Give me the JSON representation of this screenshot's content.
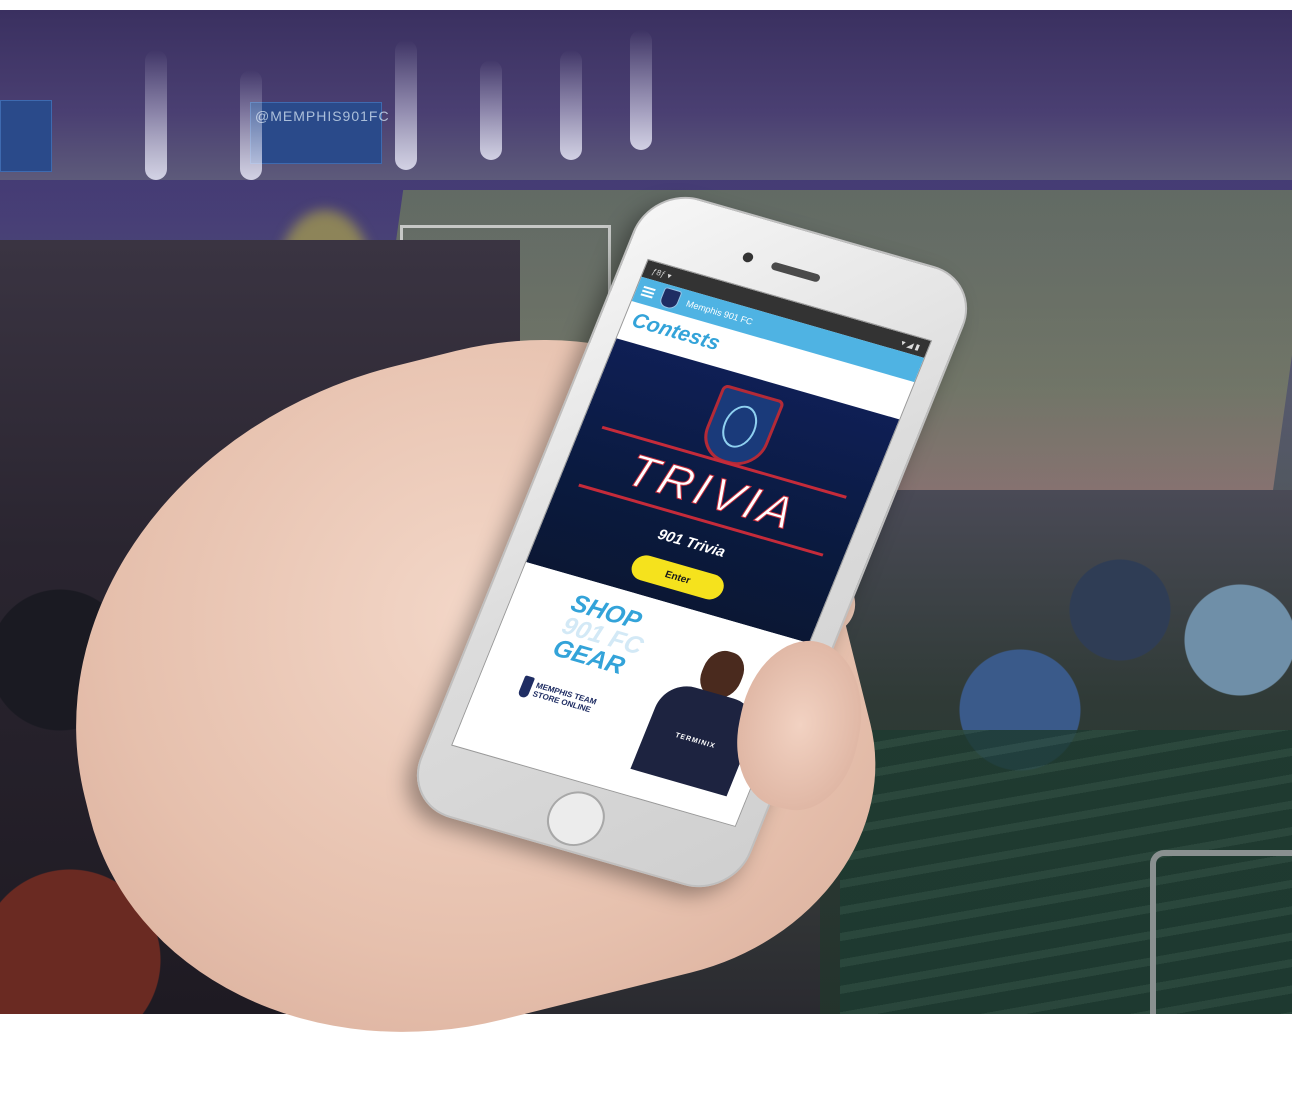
{
  "background": {
    "board_text": "@MEMPHIS901FC"
  },
  "phone": {
    "status_bar": {
      "left": "ƒ8ƒ ▾",
      "right": "▾ ◢ ▮"
    },
    "app_bar": {
      "title": "Memphis 901 FC",
      "menu_icon": "hamburger-icon",
      "logo_icon": "crest-icon",
      "accent": "#4fb3e3"
    },
    "page_heading": "Contests",
    "contest": {
      "logo_word": "TRIVIA",
      "title": "901 Trivia",
      "button_label": "Enter",
      "panel_color": "#0f1f55",
      "button_color": "#f5e21d"
    },
    "shop_banner": {
      "line1": "SHOP",
      "line2": "901 FC",
      "line3": "GEAR",
      "logo_text": "MEMPHIS TEAM STORE ONLINE",
      "jersey_text": "TERMINIX"
    }
  }
}
